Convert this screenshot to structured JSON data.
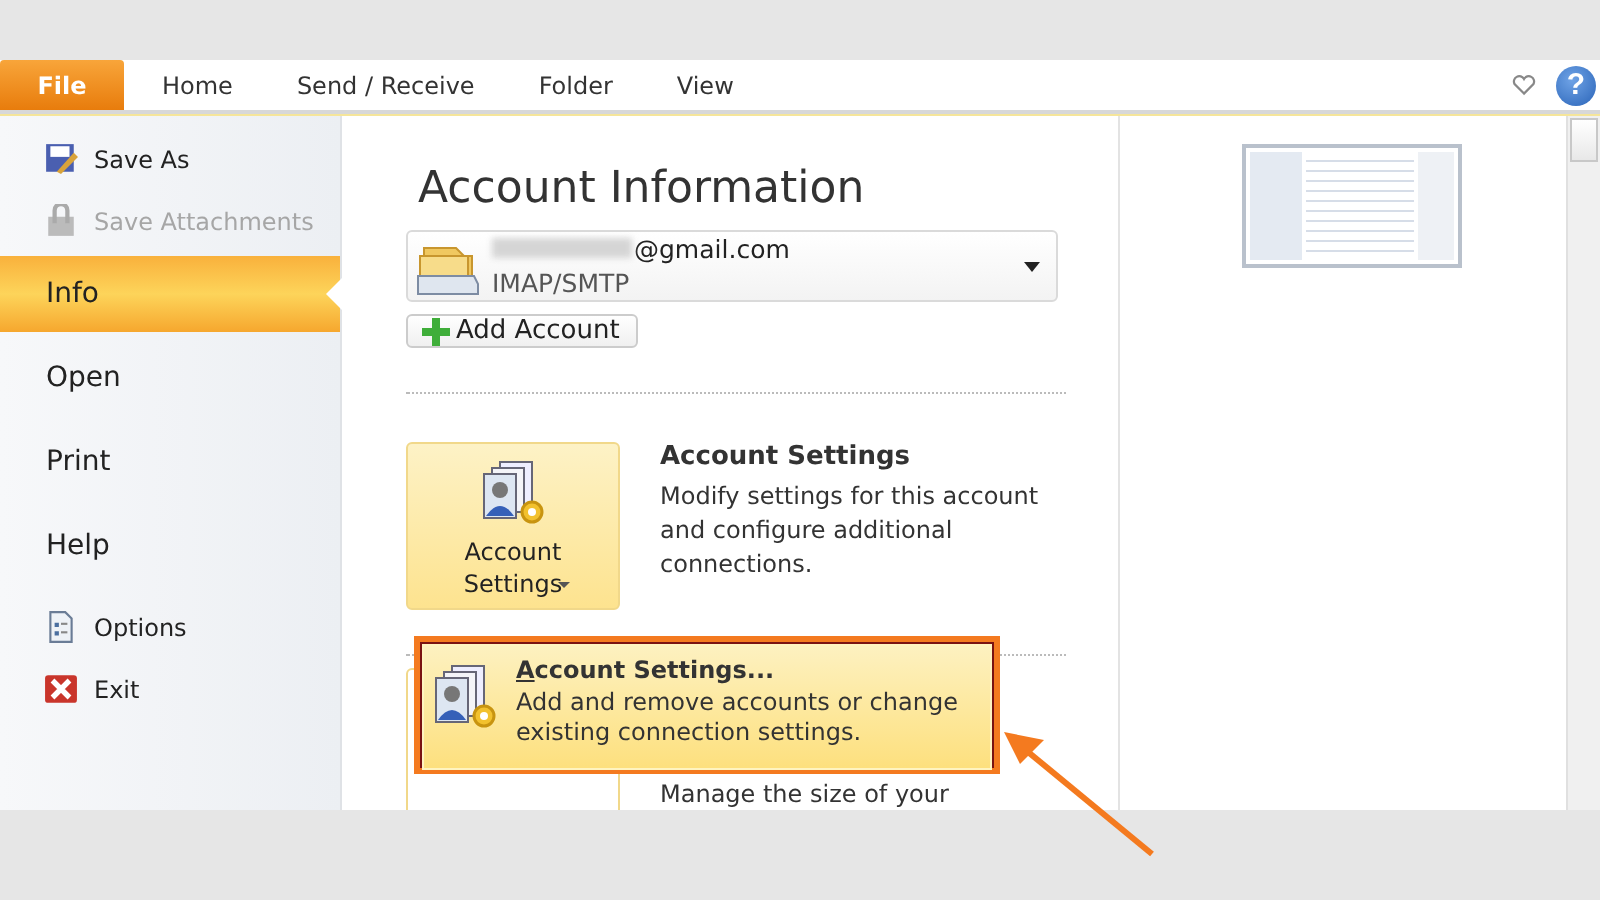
{
  "tabs": [
    {
      "label": "File",
      "selected": true
    },
    {
      "label": "Home",
      "selected": false
    },
    {
      "label": "Send / Receive",
      "selected": false
    },
    {
      "label": "Folder",
      "selected": false
    },
    {
      "label": "View",
      "selected": false
    }
  ],
  "help_button": "?",
  "sidebar": {
    "items": [
      {
        "label": "Save As",
        "kind": "command",
        "disabled": false,
        "selected": false
      },
      {
        "label": "Save Attachments",
        "kind": "command",
        "disabled": true,
        "selected": false
      },
      {
        "label": "Info",
        "kind": "page",
        "disabled": false,
        "selected": true
      },
      {
        "label": "Open",
        "kind": "page",
        "disabled": false,
        "selected": false
      },
      {
        "label": "Print",
        "kind": "page",
        "disabled": false,
        "selected": false
      },
      {
        "label": "Help",
        "kind": "page",
        "disabled": false,
        "selected": false
      },
      {
        "label": "Options",
        "kind": "command",
        "disabled": false,
        "selected": false
      },
      {
        "label": "Exit",
        "kind": "command",
        "disabled": false,
        "selected": false
      }
    ]
  },
  "main": {
    "title": "Account Information",
    "account": {
      "address": "@gmail.com",
      "type": "IMAP/SMTP"
    },
    "add_account_button": "Add Account",
    "sections": [
      {
        "button_label": "Account Settings",
        "heading": "Account Settings",
        "description": "Modify settings for this account and configure additional connections."
      },
      {
        "description": "Manage the size of your"
      }
    ],
    "dropdown_item": {
      "title": "Account Settings...",
      "description": "Add and remove accounts or change existing connection settings."
    }
  }
}
